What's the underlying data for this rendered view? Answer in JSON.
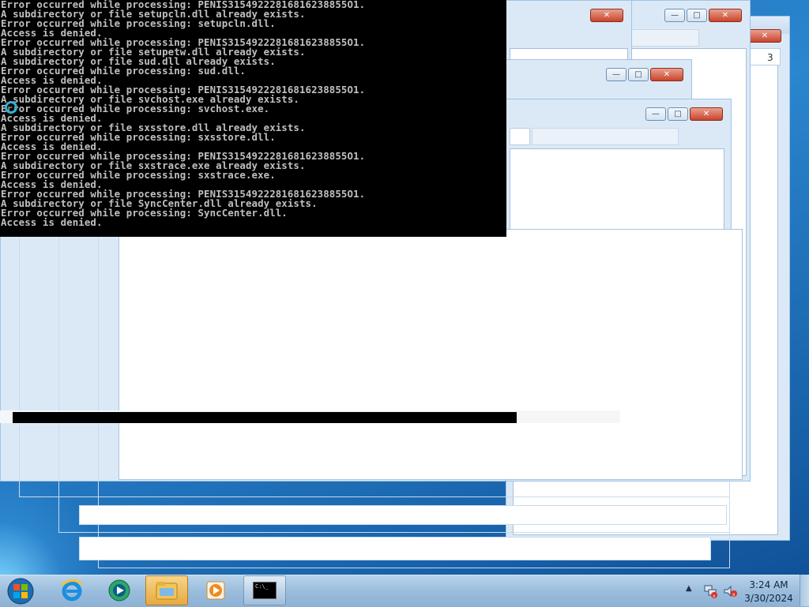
{
  "console": {
    "lines": [
      "Error occurred while processing: PENIS31549222816816238855O1.",
      "A subdirectory or file setupcln.dll already exists.",
      "Error occurred while processing: setupcln.dll.",
      "Access is denied.",
      "Error occurred while processing: PENIS31549222816816238855O1.",
      "A subdirectory or file setupetw.dll already exists.",
      "A subdirectory or file sud.dll already exists.",
      "Error occurred while processing: sud.dll.",
      "Access is denied.",
      "Error occurred while processing: PENIS31549222816816238855O1.",
      "A subdirectory or file svchost.exe already exists.",
      "Error occurred while processing: svchost.exe.",
      "Access is denied.",
      "A subdirectory or file sxsstore.dll already exists.",
      "Error occurred while processing: sxsstore.dll.",
      "Access is denied.",
      "Error occurred while processing: PENIS31549222816816238855O1.",
      "A subdirectory or file sxstrace.exe already exists.",
      "Error occurred while processing: sxstrace.exe.",
      "Access is denied.",
      "Error occurred while processing: PENIS31549222816816238855O1.",
      "A subdirectory or file SyncCenter.dll already exists.",
      "Error occurred while processing: SyncCenter.dll.",
      "Access is denied."
    ]
  },
  "progress": {
    "value": 0.83
  },
  "windows": {
    "caption_minimize": "—",
    "caption_maximize": "□",
    "caption_close": "✕",
    "partial_label": "3"
  },
  "taskbar": {
    "buttons": [
      {
        "name": "internet-explorer",
        "icon": "ie-icon"
      },
      {
        "name": "media-center",
        "icon": "media-center-icon"
      },
      {
        "name": "windows-explorer",
        "icon": "folder-icon"
      },
      {
        "name": "media-player",
        "icon": "media-player-icon"
      },
      {
        "name": "command-prompt",
        "icon": "cmd-icon"
      }
    ],
    "cmd_icon_text": "C:\\_"
  },
  "tray": {
    "time": "3:24 AM",
    "date": "3/30/2024"
  },
  "colors": {
    "console_bg": "#000000",
    "console_text": "#c0c0c0",
    "taskbar_active": "#e7a93f"
  }
}
